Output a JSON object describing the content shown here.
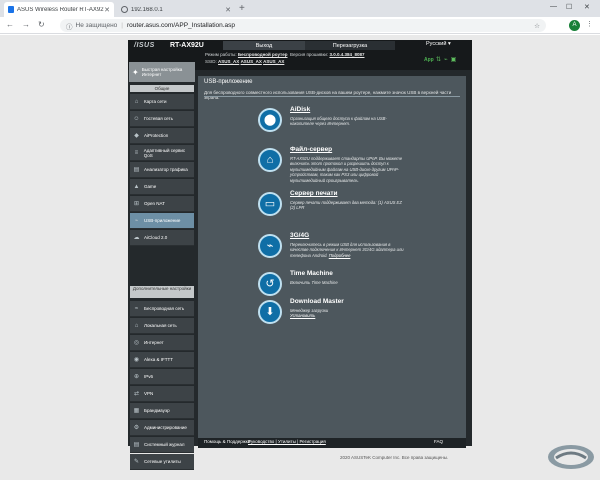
{
  "browser": {
    "tabs": [
      {
        "title": "ASUS Wireless Router RT-AX92U - ...",
        "active": true
      },
      {
        "title": "192.168.0.1",
        "active": false
      }
    ],
    "new_tab": "+",
    "security_label": "Не защищено",
    "url": "router.asus.com/APP_Installation.asp",
    "profile_initial": "A"
  },
  "router": {
    "brand": "/ISUS",
    "model": "RT-AX92U",
    "tabs": [
      "Выход",
      "Перезагрузка"
    ],
    "language": "Русский",
    "mode_label": "Режим работы:",
    "mode_value": "Беспроводной роутер",
    "firmware_label": "Версия прошивки:",
    "firmware_value": "3.0.0.4.384_8087",
    "ssid_label": "SSID:",
    "ssids": [
      "ASUS_AX",
      "ASUS_AX",
      "ASUS_AX"
    ],
    "app_label": "App"
  },
  "sidebar": {
    "quick_setup": "Быстрая настройка Интернет",
    "general_header": "Общие",
    "general_items": [
      {
        "label": "Карта сети",
        "icon": "network-map-icon",
        "glyph": "⌂"
      },
      {
        "label": "Гостевая сеть",
        "icon": "guest-network-icon",
        "glyph": "☺"
      },
      {
        "label": "AiProtection",
        "icon": "shield-icon",
        "glyph": "◆"
      },
      {
        "label": "Адаптивный сервис QoS",
        "icon": "qos-icon",
        "glyph": "≡"
      },
      {
        "label": "Анализатор трафика",
        "icon": "traffic-icon",
        "glyph": "▤"
      },
      {
        "label": "Game",
        "icon": "game-icon",
        "glyph": "▲"
      },
      {
        "label": "Open NAT",
        "icon": "nat-icon",
        "glyph": "⊞"
      },
      {
        "label": "USB-приложение",
        "icon": "usb-icon",
        "glyph": "⌁"
      },
      {
        "label": "AiCloud 2.0",
        "icon": "cloud-icon",
        "glyph": "☁"
      }
    ],
    "advanced_header": "Дополнительные настройки",
    "advanced_items": [
      {
        "label": "Беспроводная сеть",
        "icon": "wireless-icon",
        "glyph": "≈"
      },
      {
        "label": "Локальная сеть",
        "icon": "lan-icon",
        "glyph": "⌂"
      },
      {
        "label": "Интернет",
        "icon": "globe-icon",
        "glyph": "◎"
      },
      {
        "label": "Alexa & IFTTT",
        "icon": "alexa-icon",
        "glyph": "◉"
      },
      {
        "label": "IPv6",
        "icon": "ipv6-icon",
        "glyph": "⊕"
      },
      {
        "label": "VPN",
        "icon": "vpn-icon",
        "glyph": "⇄"
      },
      {
        "label": "Брандмауэр",
        "icon": "firewall-icon",
        "glyph": "▦"
      },
      {
        "label": "Администрирование",
        "icon": "admin-icon",
        "glyph": "⚙"
      },
      {
        "label": "Системный журнал",
        "icon": "log-icon",
        "glyph": "▤"
      },
      {
        "label": "Сетевые утилиты",
        "icon": "tools-icon",
        "glyph": "✎"
      }
    ],
    "selected": "USB-приложение"
  },
  "content": {
    "title": "USB-приложение",
    "subtitle": "Для беспроводного совместного использования USB-дисков на вашем роутере, нажмите значок USB в верхней части экрана.",
    "items": [
      {
        "name": "AiDisk",
        "icon": "aidisk-icon",
        "glyph": "⬤",
        "desc": "Организация общего доступа к файлам на USB-накопителе через Интернет.",
        "link": ""
      },
      {
        "name": "Файл-сервер",
        "icon": "file-server-icon",
        "glyph": "⌂",
        "desc": "RT-AX92U поддерживает стандарты UPnP. Вы можете включить этот протокол и разрешить доступ к мультимедийным файлам на USB-диске другим UPnP-устройствам, таким как PS3 или цифровой мультимедийный проигрыватель.",
        "link": ""
      },
      {
        "name": "Сервер печати",
        "icon": "printer-icon",
        "glyph": "▭",
        "desc": "Сервер печати поддерживает два метода: (1) ASUS EZ (2) LPR",
        "link": ""
      },
      {
        "name": "3G/4G",
        "icon": "modem-icon",
        "glyph": "⌁",
        "desc": "Переключитесь в режим USB для использования в качестве подключения к Интернет 3G/4G адаптера или телефона Android.",
        "link": "Подробнее"
      },
      {
        "name": "Time Machine",
        "icon": "time-machine-icon",
        "glyph": "↺",
        "desc": "Включить Time Machine",
        "link": ""
      },
      {
        "name": "Download Master",
        "icon": "download-master-icon",
        "glyph": "⬇",
        "desc": "Менеджер загрузки",
        "link": "Установить"
      }
    ]
  },
  "footer": {
    "help": "Помощь & Поддержка",
    "links1": "Руководство | Утилиты | Регистрация",
    "links2": "продукта | Обратная связь",
    "faq": "FAQ",
    "copyright": "2020 ASUSTeK Computer Inc. Все права защищены."
  }
}
